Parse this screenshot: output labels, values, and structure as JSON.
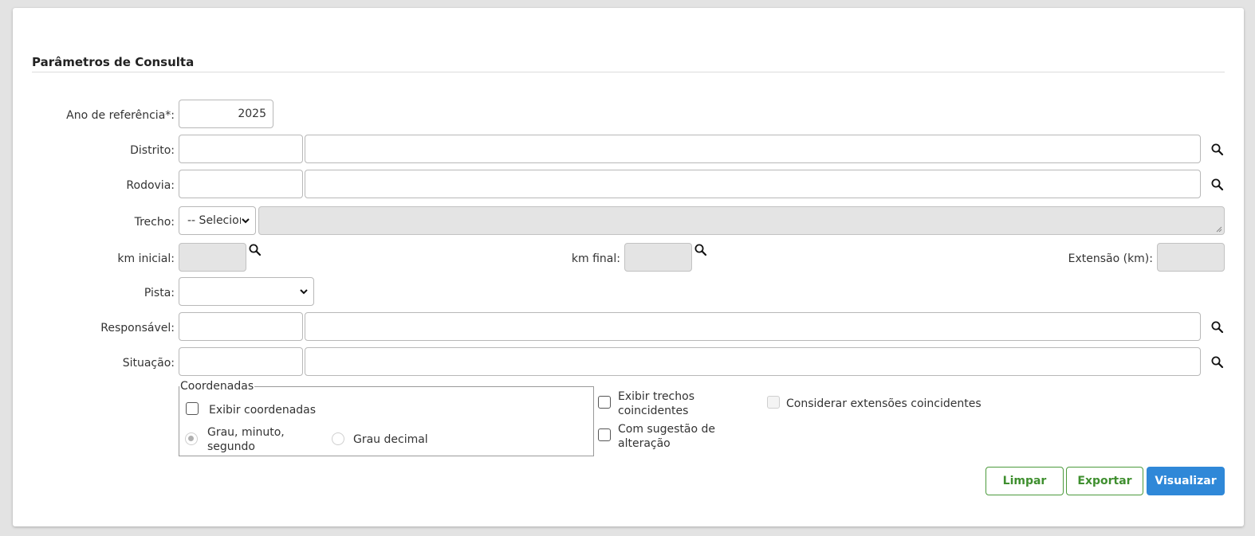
{
  "section": {
    "title": "Parâmetros de Consulta"
  },
  "fields": {
    "ano": {
      "label": "Ano de referência*:",
      "value": "2025"
    },
    "distrito": {
      "label": "Distrito:",
      "code": "",
      "name": ""
    },
    "rodovia": {
      "label": "Rodovia:",
      "code": "",
      "name": ""
    },
    "trecho": {
      "label": "Trecho:",
      "selected": "-- Selecione --",
      "description": ""
    },
    "km_inicial": {
      "label": "km inicial:",
      "value": ""
    },
    "km_final": {
      "label": "km final:",
      "value": ""
    },
    "extensao": {
      "label": "Extensão (km):",
      "value": ""
    },
    "pista": {
      "label": "Pista:",
      "selected": ""
    },
    "responsavel": {
      "label": "Responsável:",
      "code": "",
      "name": ""
    },
    "situacao": {
      "label": "Situação:",
      "code": "",
      "name": ""
    }
  },
  "coordenadas": {
    "legend": "Coordenadas",
    "exibir_label": "Exibir coordenadas",
    "exibir_checked": false,
    "formats": [
      {
        "label": "Grau, minuto, segundo",
        "checked": true
      },
      {
        "label": "Grau decimal",
        "checked": false
      }
    ]
  },
  "options": {
    "trechos_coincidentes": "Exibir trechos coincidentes",
    "sugestao_alteracao": "Com sugestão de alteração",
    "extensoes_coincidentes": "Considerar extensões coincidentes"
  },
  "buttons": {
    "limpar": "Limpar",
    "exportar": "Exportar",
    "visualizar": "Visualizar"
  },
  "colors": {
    "primary": "#2f88d8",
    "outline_green": "#3f8f2f",
    "disabled_bg": "#e4e4e4"
  },
  "icons": {
    "search": "search-icon",
    "chevron": "chevron-down-icon"
  }
}
